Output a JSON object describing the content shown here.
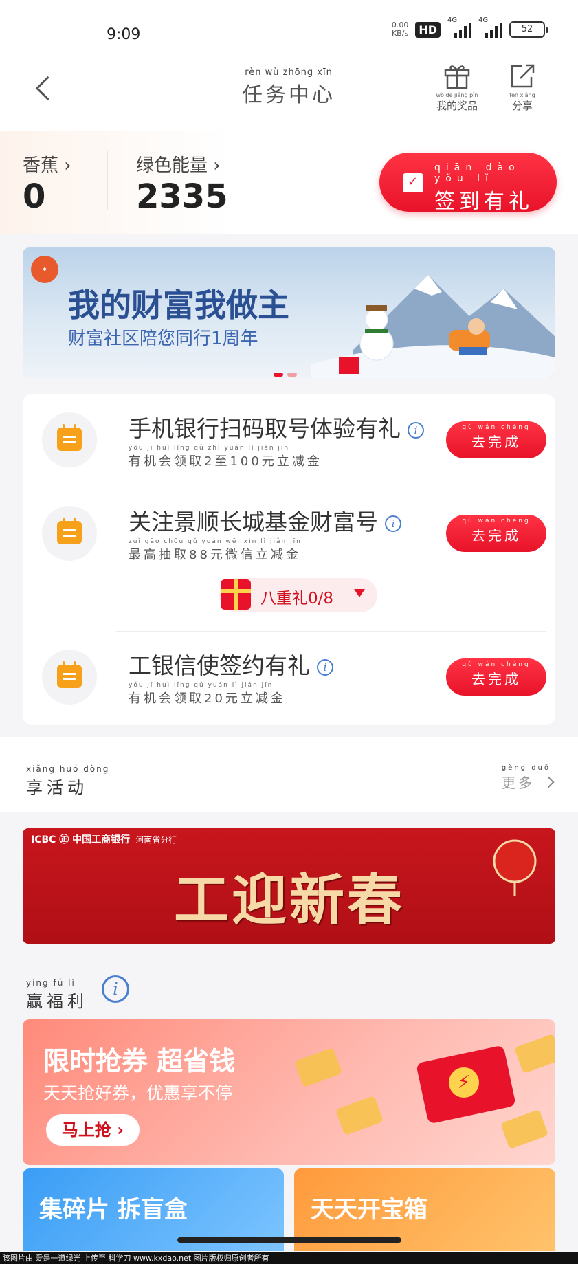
{
  "status_bar": {
    "time": "9:09",
    "speed_value": "0.00",
    "speed_unit": "KB/s",
    "hd": "HD",
    "net1": "4G",
    "net2": "4G",
    "battery": "52"
  },
  "header": {
    "title": "任务中心",
    "title_pinyin": "rèn wù zhōng xīn",
    "gift_label": "我的奖品",
    "gift_pinyin": "wǒ de jiǎng pǐn",
    "share_label": "分享",
    "share_pinyin": "fēn xiǎng"
  },
  "stats": {
    "banana_label": "香蕉",
    "banana_value": "0",
    "energy_label": "绿色能量",
    "energy_value": "2335",
    "signin_label": "签到有礼",
    "signin_pinyin": "qiān dào yǒu lǐ"
  },
  "banner1": {
    "title": "我的财富我做主",
    "subtitle": "财富社区陪您同行1周年"
  },
  "tasks": [
    {
      "title": "手机银行扫码取号体验有礼",
      "sub": "有机会领取2至100元立减金",
      "sub_pinyin": "yǒu jī huì lǐng qǔ zhì yuán lì jiǎn jīn",
      "button": "去完成",
      "button_pinyin": "qù wán chéng"
    },
    {
      "title": "关注景顺长城基金财富号",
      "sub": "最高抽取88元微信立减金",
      "sub_pinyin": "zuì gāo chōu qǔ yuán wēi xìn lì jiǎn jīn",
      "button": "去完成",
      "button_pinyin": "qù wán chéng",
      "gift_label": "八重礼0/8"
    },
    {
      "title": "工银信使签约有礼",
      "sub": "有机会领取20元立减金",
      "sub_pinyin": "yǒu jī huì lǐng qǔ yuán lì jiǎn jīn",
      "button": "去完成",
      "button_pinyin": "qù wán chéng"
    }
  ],
  "activities": {
    "title": "享活动",
    "title_pinyin": "xiǎng huó dòng",
    "more": "更多",
    "more_pinyin": "gèng duō",
    "brand": "ICBC ㊣ 中国工商银行",
    "branch": "河南省分行",
    "slogan": "工迎新春"
  },
  "welfare": {
    "title": "赢福利",
    "title_pinyin": "yíng fú lì",
    "promo_title": "限时抢券 超省钱",
    "promo_sub": "天天抢好券，优惠享不停",
    "promo_button": "马上抢 ›",
    "tile1": "集碎片 拆盲盒",
    "tile2": "天天开宝箱"
  },
  "footer": "该图片由 爱是一道绿光 上传至 科学刀 www.kxdao.net 图片版权归原创者所有",
  "colors": {
    "accent": "#e8132a",
    "task_icon": "#f7a11a",
    "info": "#4a7fd0"
  }
}
